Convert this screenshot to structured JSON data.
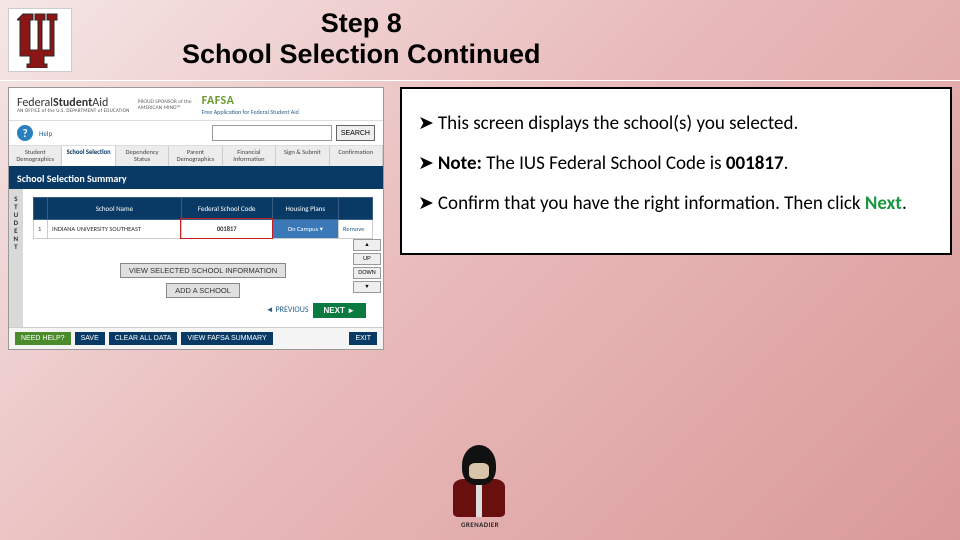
{
  "header": {
    "title_line1": "Step 8",
    "title_line2": "School Selection Continued"
  },
  "fafsa": {
    "logo_main_a": "Federal",
    "logo_main_b": "Student",
    "logo_main_c": "Aid",
    "logo_sub": "AN OFFICE of the U.S. DEPARTMENT of EDUCATION",
    "sponsor": "PROUD SPONSOR of the AMERICAN MIND™",
    "brand": "FAFSA",
    "brand_sub": "Free Application for Federal Student Aid",
    "help_label": "Help",
    "search_placeholder": "",
    "search_btn": "SEARCH",
    "tabs": [
      "Student Demographics",
      "School Selection",
      "Dependency Status",
      "Parent Demographics",
      "Financial Information",
      "Sign & Submit",
      "Confirmation"
    ],
    "active_tab_index": 1,
    "section_title": "School Selection Summary",
    "vstripe": "STUDENT",
    "table": {
      "headers": [
        "",
        "School Name",
        "Federal School Code",
        "Housing Plans",
        ""
      ],
      "row": {
        "idx": "1",
        "name": "INDIANA UNIVERSITY SOUTHEAST",
        "code": "001817",
        "housing": "On Campus ▾",
        "remove": "Remove"
      }
    },
    "updown": [
      "▲",
      "UP",
      "DOWN",
      "▼"
    ],
    "btn_view": "VIEW SELECTED SCHOOL INFORMATION",
    "btn_add": "ADD A SCHOOL",
    "prev": "◄ PREVIOUS",
    "next": "NEXT ►",
    "bottom": {
      "need_help": "NEED HELP?",
      "save": "SAVE",
      "clear": "CLEAR ALL DATA",
      "summary": "VIEW FAFSA SUMMARY",
      "exit": "EXIT"
    }
  },
  "callout": {
    "line1": "This screen displays the school(s) you selected.",
    "line2a": "Note:",
    "line2b": " The IUS Federal School Code is ",
    "code": "001817",
    "line3a": "Confirm that you have the right information. Then click ",
    "next_word": "Next",
    "period": "."
  },
  "grenadier_label": "GRENADIER"
}
